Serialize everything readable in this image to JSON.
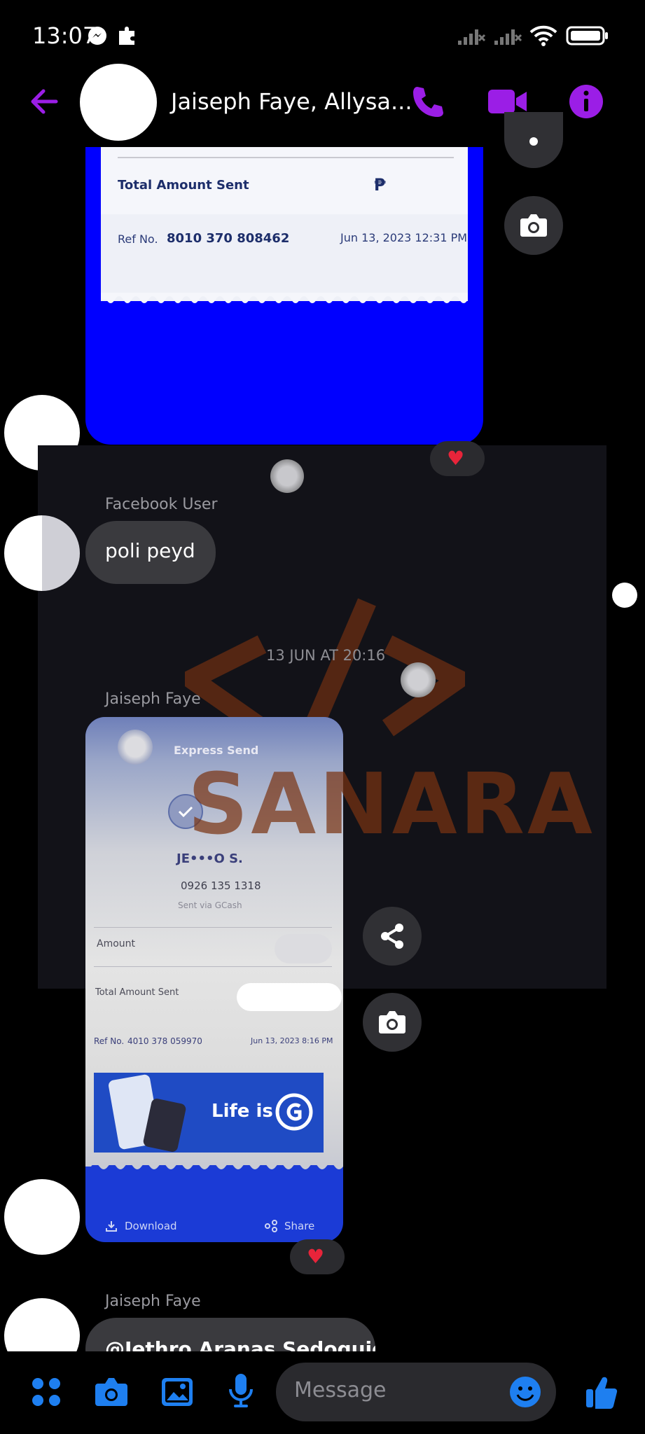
{
  "status_bar": {
    "time": "13:07"
  },
  "header": {
    "title": "Jaiseph Faye, Allysa...",
    "icons": [
      "back-arrow-icon",
      "phone-icon",
      "video-icon",
      "info-icon"
    ],
    "accent_color": "#9b1ee6"
  },
  "messages": {
    "receipt1": {
      "total_label": "Total Amount Sent",
      "currency": "₱",
      "ref_label": "Ref No.",
      "ref_no": "8010 370 808462",
      "date": "Jun 13, 2023 12:31 PM"
    },
    "msg1": {
      "sender": "Facebook User",
      "text": "poli peyd"
    },
    "date_divider": "13 JUN AT 20:16",
    "msg2": {
      "sender": "Jaiseph Faye",
      "receipt": {
        "title": "Express Send",
        "name": "JE•••O S.",
        "phone": "0926 135 1318",
        "via": "Sent via GCash",
        "amount_label": "Amount",
        "total_label": "Total Amount Sent",
        "ref_label": "Ref No.",
        "ref_no": "4010 378 059970",
        "date": "Jun 13, 2023 8:16 PM",
        "banner": "Life is",
        "download": "Download",
        "share": "Share"
      }
    },
    "msg3": {
      "sender": "Jaiseph Faye",
      "text": "@Jethro Aranas Sedoguio"
    },
    "watermark": "SANARA"
  },
  "composer": {
    "placeholder": "Message"
  }
}
